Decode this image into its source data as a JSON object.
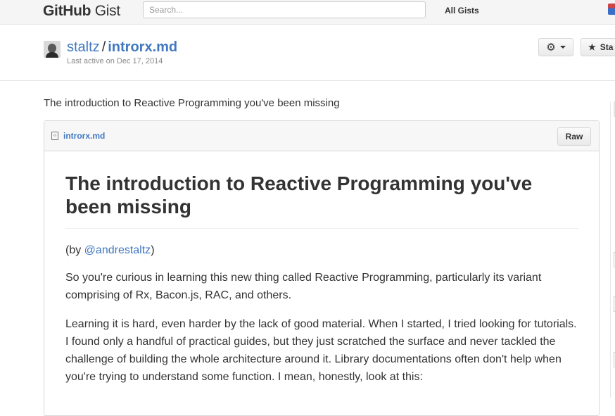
{
  "topbar": {
    "logo_bold": "GitHub",
    "logo_light": "Gist",
    "search_placeholder": "Search...",
    "all_gists": "All Gists"
  },
  "gist": {
    "owner": "staltz",
    "separator": "/",
    "filename_title": "introrx.md",
    "last_active": "Last active on Dec 17, 2014",
    "star_label": "Sta",
    "description": "The introduction to Reactive Programming you've been missing"
  },
  "file": {
    "icon": "file-code-icon",
    "name": "introrx.md",
    "raw_label": "Raw",
    "content": {
      "h1": "The introduction to Reactive Programming you've been missing",
      "by_prefix": "(by ",
      "by_link": "@andrestaltz",
      "by_suffix": ")",
      "p_intro": "So you're curious in learning this new thing called Reactive Programming, particularly its variant comprising of Rx, Bacon.js, RAC, and others.",
      "p_learn": "Learning it is hard, even harder by the lack of good material. When I started, I tried looking for tutorials. I found only a handful of practical guides, but they just scratched the surface and never tackled the challenge of building the whole architecture around it. Library documentations often don't help when you're trying to understand some function. I mean, honestly, look at this:"
    }
  },
  "colors": {
    "link": "#4078c0",
    "text": "#333333",
    "topbar_bg": "#f5f5f5"
  }
}
